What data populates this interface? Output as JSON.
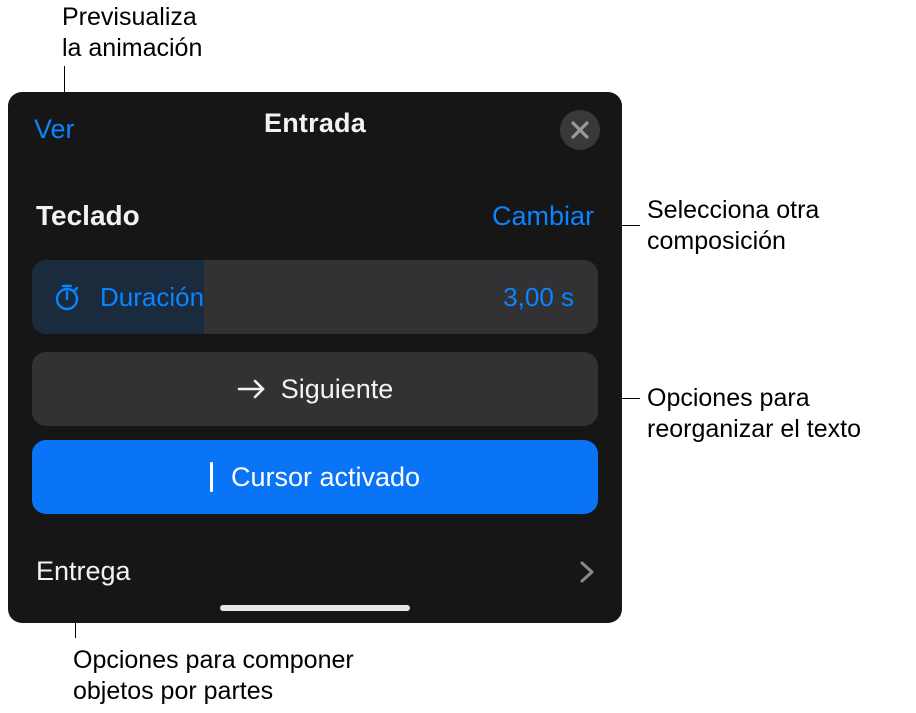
{
  "annotations": {
    "ver": "Previsualiza\nla animación",
    "cambiar": "Selecciona otra\ncomposición",
    "siguiente": "Opciones para\nreorganizar el texto",
    "entrega": "Opciones para componer\nobjetos por partes"
  },
  "panel": {
    "ver_label": "Ver",
    "title": "Entrada",
    "section_label": "Teclado",
    "section_action": "Cambiar",
    "duration": {
      "label": "Duración",
      "value": "3,00 s"
    },
    "next_label": "Siguiente",
    "cursor_label": "Cursor activado",
    "delivery_label": "Entrega"
  }
}
